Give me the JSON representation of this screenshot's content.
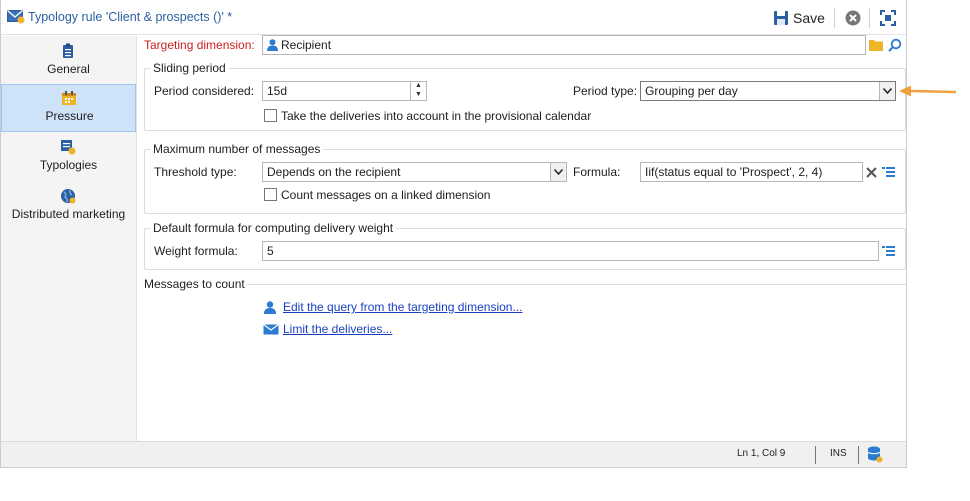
{
  "window": {
    "title": "Typology rule 'Client & prospects ()' *",
    "save_label": "Save"
  },
  "sidebar": {
    "items": [
      {
        "label": "General",
        "icon": "clipboard-icon",
        "active": false
      },
      {
        "label": "Pressure",
        "icon": "calendar-icon",
        "active": true
      },
      {
        "label": "Typologies",
        "icon": "typologies-icon",
        "active": false
      },
      {
        "label": "Distributed marketing",
        "icon": "globe-icon",
        "active": false
      }
    ]
  },
  "targeting": {
    "label": "Targeting dimension:",
    "value": "Recipient"
  },
  "sliding_period": {
    "title": "Sliding period",
    "period_considered_label": "Period considered:",
    "period_considered_value": "15d",
    "period_type_label": "Period type:",
    "period_type_value": "Grouping per day",
    "provisional_label": "Take the deliveries into account in the provisional calendar"
  },
  "max_messages": {
    "title": "Maximum number of messages",
    "threshold_label": "Threshold type:",
    "threshold_value": "Depends on the recipient",
    "formula_label": "Formula:",
    "formula_value": "Iif(status equal to 'Prospect', 2, 4)",
    "linked_label": "Count messages on a linked dimension"
  },
  "delivery_weight": {
    "title": "Default formula for computing delivery weight",
    "weight_label": "Weight formula:",
    "weight_value": "5"
  },
  "messages_to_count": {
    "title": "Messages to count",
    "edit_query_link": "Edit the query from the targeting dimension...",
    "limit_deliveries_link": "Limit the deliveries..."
  },
  "status": {
    "position": "Ln 1, Col 9",
    "mode": "INS"
  },
  "colors": {
    "accent": "#2b5fa0",
    "arrow": "#f0a040",
    "active_bg": "#cfe3f8",
    "required": "#cc1e1e"
  }
}
